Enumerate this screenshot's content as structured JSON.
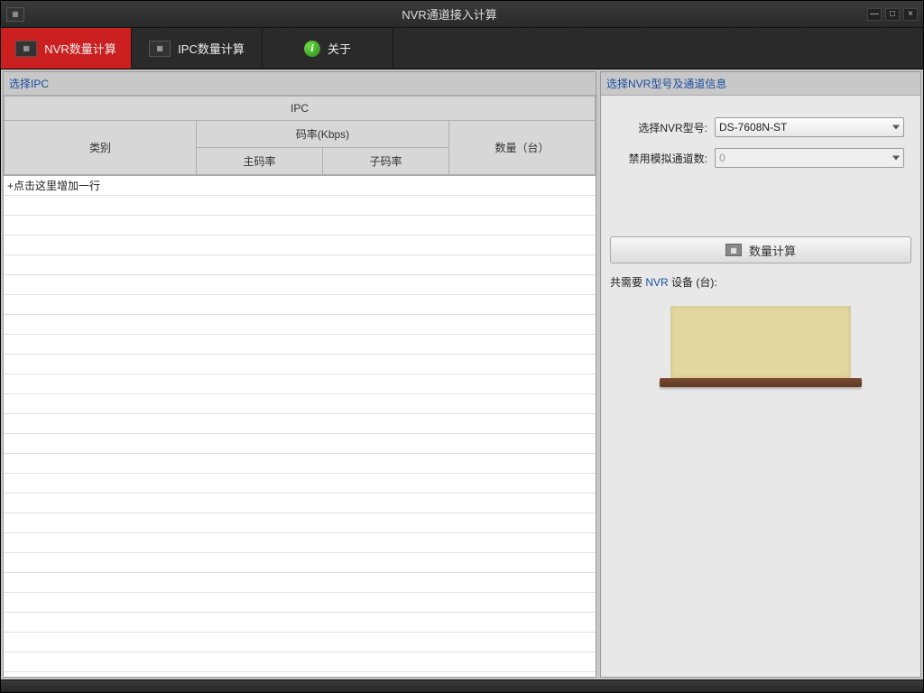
{
  "window": {
    "title": "NVR通道接入计算"
  },
  "tabs": {
    "nvr": "NVR数量计算",
    "ipc": "IPC数量计算",
    "about": "关于"
  },
  "left": {
    "header": "选择IPC",
    "table": {
      "group": "IPC",
      "category": "类别",
      "bitrate_group": "码率(Kbps)",
      "main_stream": "主码率",
      "sub_stream": "子码率",
      "quantity": "数量（台）"
    },
    "add_row": "+点击这里增加一行"
  },
  "right": {
    "header": "选择NVR型号及通道信息",
    "form": {
      "model_label": "选择NVR型号:",
      "model_value": "DS-7608N-ST",
      "disable_analog_label": "禁用模拟通道数:",
      "disable_analog_value": "0"
    },
    "calc_button": "数量计算",
    "result_prefix": "共需要 ",
    "result_link": "NVR",
    "result_suffix": " 设备 (台):"
  }
}
